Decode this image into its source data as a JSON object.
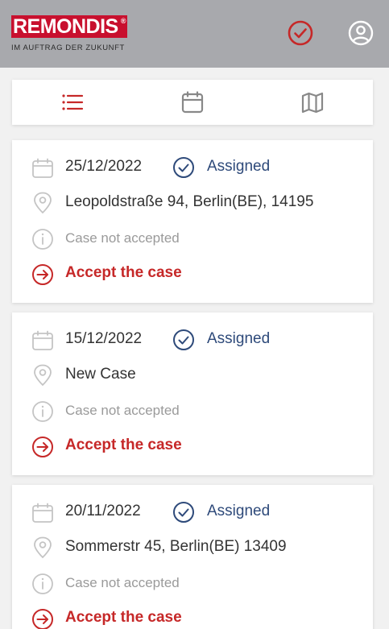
{
  "brand": {
    "name": "REMONDIS",
    "registered": "®",
    "tagline": "IM AUFTRAG DER ZUKUNFT"
  },
  "header_icons": [
    "check-circle-icon",
    "user-circle-icon"
  ],
  "tabs": [
    {
      "name": "list-icon",
      "active": true
    },
    {
      "name": "calendar-icon",
      "active": false
    },
    {
      "name": "map-icon",
      "active": false
    }
  ],
  "colors": {
    "header": "#a8a9ad",
    "accent_red": "#c62828",
    "status_blue": "#2e4a7a",
    "icon_gray": "#c4c4c4"
  },
  "cases": [
    {
      "date": "25/12/2022",
      "status": "Assigned",
      "address": "Leopoldstraße 94, Berlin(BE), 14195",
      "note": "Case not accepted",
      "action": "Accept the case"
    },
    {
      "date": "15/12/2022",
      "status": "Assigned",
      "address": "New Case",
      "note": "Case not accepted",
      "action": "Accept the case"
    },
    {
      "date": "20/11/2022",
      "status": "Assigned",
      "address": "Sommerstr 45, Berlin(BE) 13409",
      "note": "Case not accepted",
      "action": "Accept the case"
    }
  ]
}
